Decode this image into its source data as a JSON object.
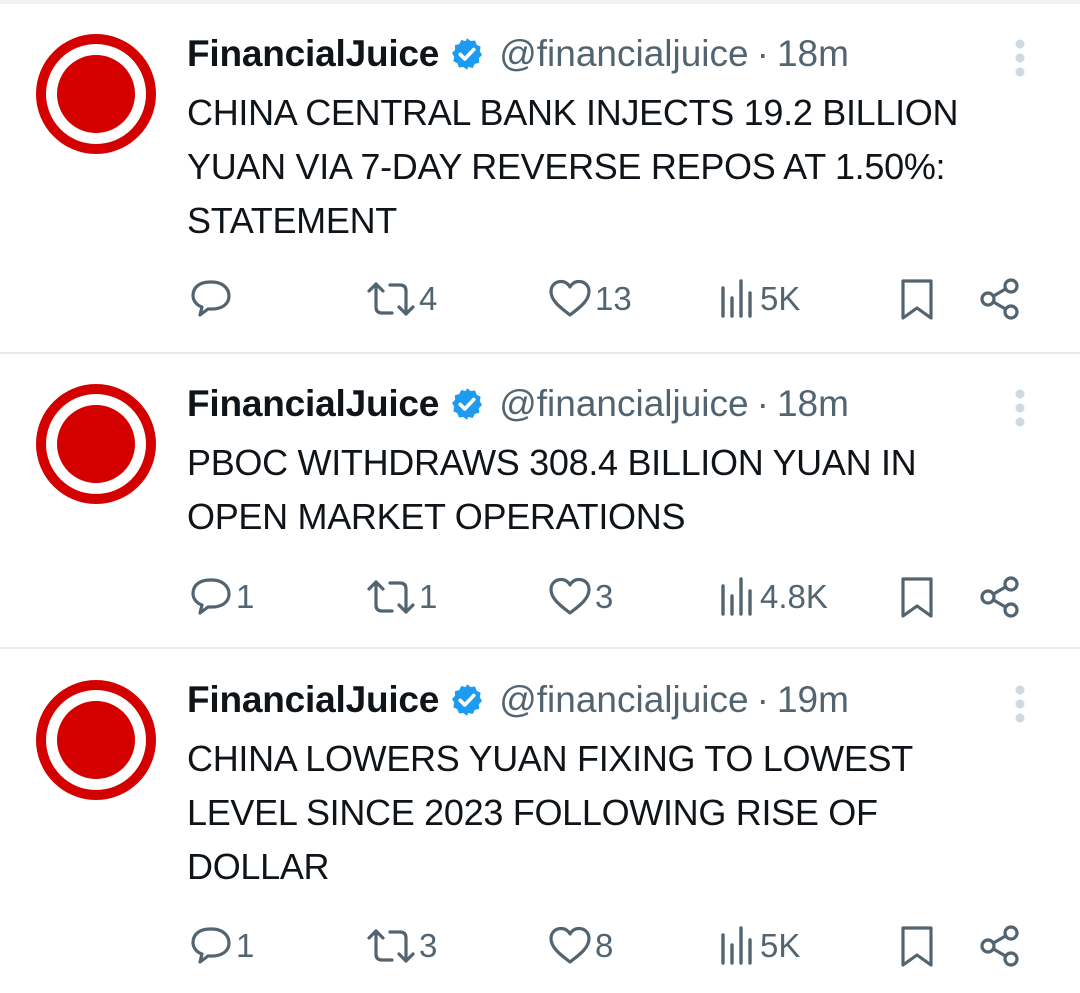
{
  "feed": {
    "tweets": [
      {
        "author": "FinancialJuice",
        "handle": "@financialjuice",
        "separator": "·",
        "time": "18m",
        "lines": [
          "CHINA CENTRAL BANK INJECTS 19.2 BILLION",
          "YUAN VIA 7-DAY REVERSE REPOS AT 1.50%:",
          "STATEMENT"
        ],
        "reply_count": "",
        "retweet_count": "4",
        "like_count": "13",
        "view_count": "5K"
      },
      {
        "author": "FinancialJuice",
        "handle": "@financialjuice",
        "separator": "·",
        "time": "18m",
        "lines": [
          "PBOC WITHDRAWS 308.4 BILLION YUAN IN",
          "OPEN MARKET OPERATIONS"
        ],
        "reply_count": "1",
        "retweet_count": "1",
        "like_count": "3",
        "view_count": "4.8K"
      },
      {
        "author": "FinancialJuice",
        "handle": "@financialjuice",
        "separator": "·",
        "time": "19m",
        "lines": [
          "CHINA LOWERS YUAN FIXING TO LOWEST",
          "LEVEL SINCE 2023 FOLLOWING RISE OF",
          "DOLLAR"
        ],
        "reply_count": "1",
        "retweet_count": "3",
        "like_count": "8",
        "view_count": "5K"
      }
    ]
  },
  "icons": {
    "avatar": "red-ring-logo-icon",
    "verified": "verified-badge-icon",
    "more": "more-vertical-icon",
    "reply": "reply-bubble-icon",
    "retweet": "retweet-icon",
    "like": "heart-icon",
    "views": "views-bar-chart-icon",
    "bookmark": "bookmark-icon",
    "share": "share-icon"
  },
  "colors": {
    "avatar_red": "#d40000",
    "verified_blue": "#1d9bf0",
    "muted_text": "#536471",
    "icon_gray": "#536471",
    "divider": "#e6ecf0"
  }
}
